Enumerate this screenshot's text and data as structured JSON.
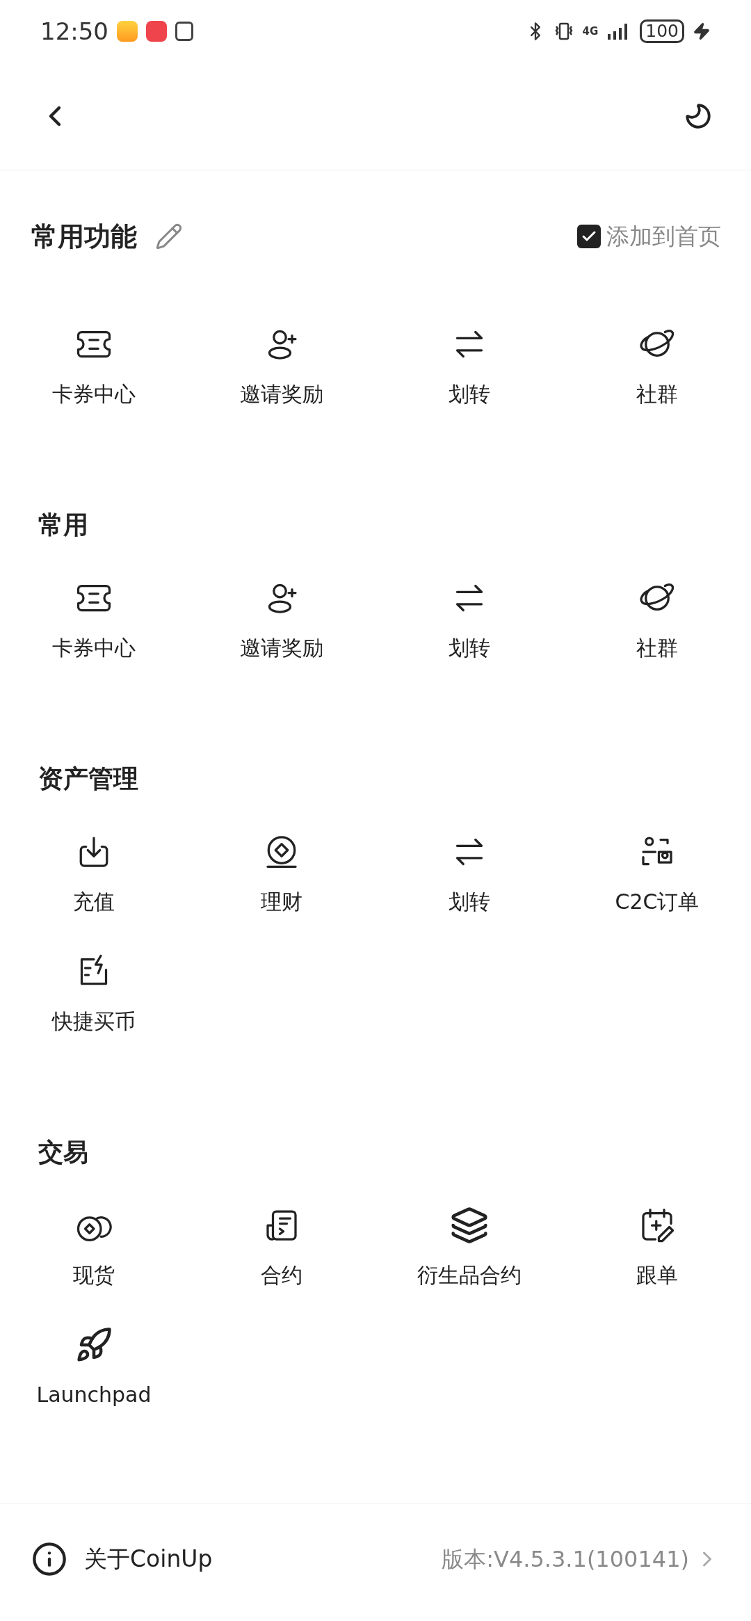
{
  "status_bar": {
    "time": "12:50",
    "network": "4G",
    "battery": "100"
  },
  "favorites": {
    "title": "常用功能",
    "add_to_home": {
      "label": "添加到首页",
      "checked": true
    },
    "items": [
      {
        "label": "卡券中心"
      },
      {
        "label": "邀请奖励"
      },
      {
        "label": "划转"
      },
      {
        "label": "社群"
      }
    ]
  },
  "sections": [
    {
      "title": "常用",
      "items": [
        {
          "label": "卡券中心"
        },
        {
          "label": "邀请奖励"
        },
        {
          "label": "划转"
        },
        {
          "label": "社群"
        }
      ]
    },
    {
      "title": "资产管理",
      "items": [
        {
          "label": "充值"
        },
        {
          "label": "理财"
        },
        {
          "label": "划转"
        },
        {
          "label": "C2C订单"
        },
        {
          "label": "快捷买币"
        }
      ]
    },
    {
      "title": "交易",
      "items": [
        {
          "label": "现货"
        },
        {
          "label": "合约"
        },
        {
          "label": "衍生品合约"
        },
        {
          "label": "跟单"
        },
        {
          "label": "Launchpad"
        }
      ]
    }
  ],
  "footer": {
    "about": "关于CoinUp",
    "version": "版本:V4.5.3.1(100141)"
  }
}
